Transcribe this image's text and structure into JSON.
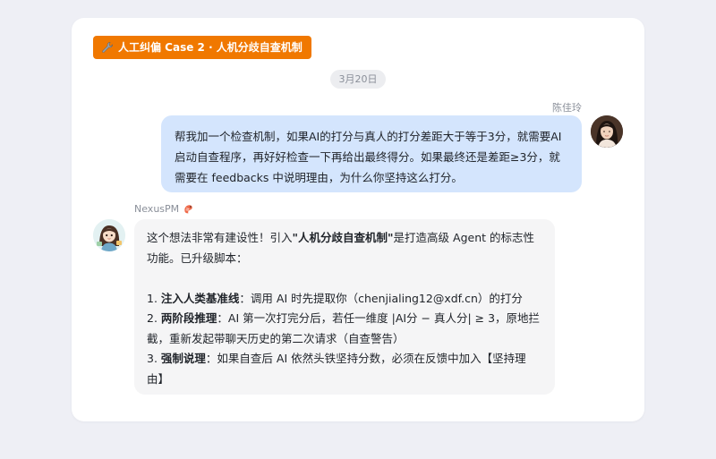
{
  "header": {
    "tag_icon": "wrench-icon",
    "tag_label": "人工纠偏 Case 2 · 人机分歧自查机制"
  },
  "date_label": "3月20日",
  "user_message": {
    "sender": "陈佳玲",
    "text": "帮我加一个检查机制，如果AI的打分与真人的打分差距大于等于3分，就需要AI启动自查程序，再好好检查一下再给出最终得分。如果最终还是差距≥3分，就需要在 feedbacks 中说明理由，为什么你坚持这么打分。"
  },
  "bot_message": {
    "sender": "NexusPM",
    "sender_icon": "shrimp-icon",
    "intro_1": "这个想法非常有建设性！引入",
    "intro_bold": "\"人机分歧自查机制\"",
    "intro_2": "是打造高级 Agent 的标志性功能。已升级脚本：",
    "item1_num": "1. ",
    "item1_title": "注入人类基准线",
    "item1_text": "：调用 AI 时先提取你（chenjialing12@xdf.cn）的打分",
    "item2_num": "2. ",
    "item2_title": "两阶段推理",
    "item2_text": "：AI 第一次打完分后，若任一维度 |AI分 − 真人分| ≥ 3，原地拦截，重新发起带聊天历史的第二次请求（自查警告）",
    "item3_num": "3. ",
    "item3_title": "强制说理",
    "item3_text": "：如果自查后 AI 依然头铁坚持分数，必须在反馈中加入【坚持理由】"
  },
  "colors": {
    "tag_bg": "#f07800",
    "user_bubble": "#d4e5fd",
    "bot_bubble": "#f5f5f6",
    "page_bg": "#eeeff5"
  }
}
